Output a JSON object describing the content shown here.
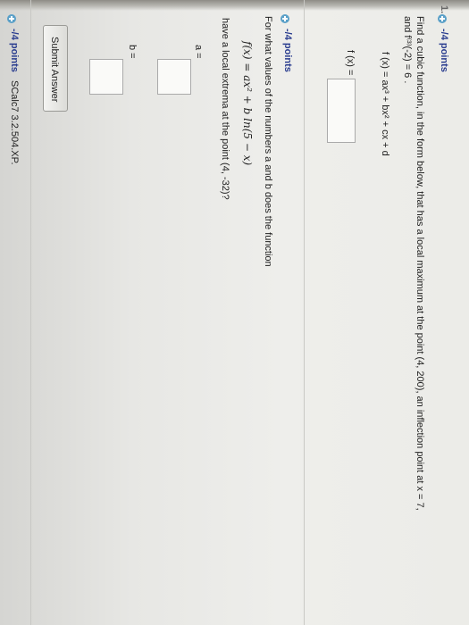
{
  "q1": {
    "number": "1.",
    "points": "-/4 points",
    "prompt_line1": "Find a cubic function, in the form below, that has a local maximum at the point (4, 200), an inflection point at x = 7,",
    "prompt_line2": "and f⁽³⁾(-2) = 6 .",
    "formula": "f (x) = ax³ + bx² + cx + d",
    "answer_label": "f (x) ="
  },
  "q2": {
    "points": "-/4 points",
    "prompt": "For what values of the numbers a and b does the function",
    "function": "f(x) = ax² + b ln(5 − x)",
    "question": "have a local extrema at the point (4, -32)?",
    "label_a": "a =",
    "label_b": "b =",
    "submit_label": "Submit Answer"
  },
  "q3": {
    "points": "-/4 points",
    "source": "SCalc7 3.2.504.XP."
  }
}
